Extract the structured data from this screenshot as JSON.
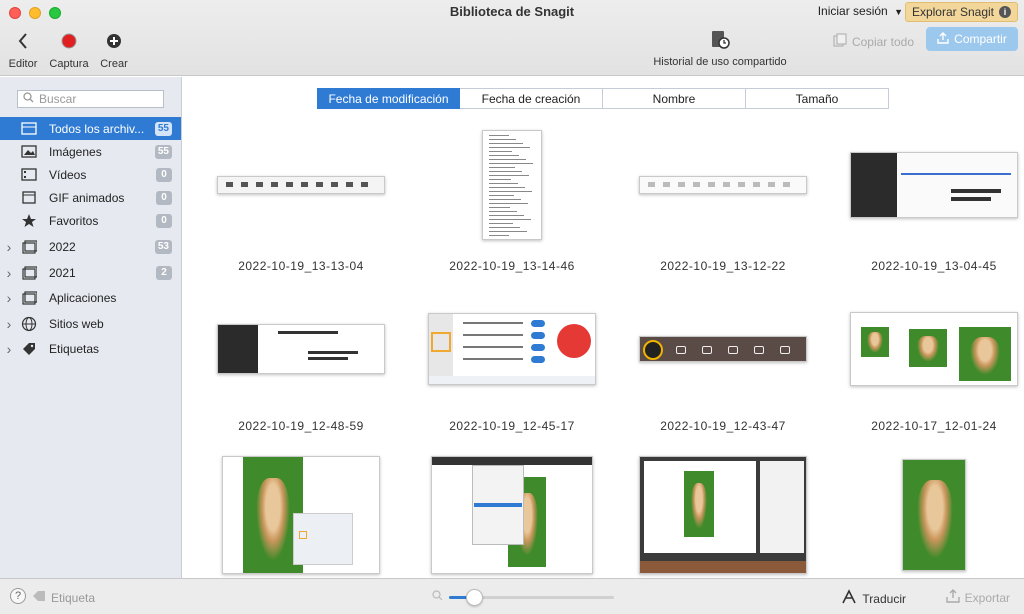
{
  "window": {
    "title": "Biblioteca de Snagit"
  },
  "toolbar": {
    "editor_label": "Editor",
    "capture_label": "Captura",
    "create_label": "Crear",
    "history_label": "Historial de uso compartido",
    "login_label": "Iniciar sesión",
    "explore_label": "Explorar Snagit",
    "copy_all_label": "Copiar todo",
    "share_label": "Compartir"
  },
  "sidebar": {
    "search_placeholder": "Buscar",
    "items": [
      {
        "label": "Todos los archiv...",
        "count": "55",
        "icon": "library-icon",
        "active": true,
        "expandable": false
      },
      {
        "label": "Imágenes",
        "count": "55",
        "icon": "image-icon",
        "expandable": false
      },
      {
        "label": "Vídeos",
        "count": "0",
        "icon": "video-icon",
        "expandable": false
      },
      {
        "label": "GIF animados",
        "count": "0",
        "icon": "gif-icon",
        "expandable": false
      },
      {
        "label": "Favoritos",
        "count": "0",
        "icon": "star-icon",
        "expandable": false
      },
      {
        "label": "2022",
        "count": "53",
        "icon": "calendar-icon",
        "expandable": true
      },
      {
        "label": "2021",
        "count": "2",
        "icon": "calendar-icon",
        "expandable": true
      },
      {
        "label": "Aplicaciones",
        "count": "",
        "icon": "apps-icon",
        "expandable": true
      },
      {
        "label": "Sitios web",
        "count": "",
        "icon": "globe-icon",
        "expandable": true
      },
      {
        "label": "Etiquetas",
        "count": "",
        "icon": "tag-icon",
        "expandable": true
      }
    ]
  },
  "sort": {
    "options": [
      "Fecha de modificación",
      "Fecha de creación",
      "Nombre",
      "Tamaño"
    ],
    "selected": "Fecha de modificación"
  },
  "thumbnails": [
    {
      "name": "2022-10-19_13-13-04",
      "kind": "toolbar"
    },
    {
      "name": "2022-10-19_13-14-46",
      "kind": "menu"
    },
    {
      "name": "2022-10-19_13-12-22",
      "kind": "toolbar-light"
    },
    {
      "name": "2022-10-19_13-04-45",
      "kind": "web-dark"
    },
    {
      "name": "2022-10-19_12-48-59",
      "kind": "web-light"
    },
    {
      "name": "2022-10-19_12-45-17",
      "kind": "capture-panel"
    },
    {
      "name": "2022-10-19_12-43-47",
      "kind": "menubar"
    },
    {
      "name": "2022-10-17_12-01-24",
      "kind": "dog-compare"
    },
    {
      "name": "",
      "kind": "dog-dialog"
    },
    {
      "name": "",
      "kind": "dog-menu"
    },
    {
      "name": "",
      "kind": "dog-desktop"
    },
    {
      "name": "",
      "kind": "dog-photo"
    }
  ],
  "bottombar": {
    "help_label": "?",
    "tag_label": "Etiqueta",
    "zoom_level": 0.15,
    "translate_label": "Traducir",
    "export_label": "Exportar"
  },
  "colors": {
    "accent": "#2f7bd4",
    "explore_bg": "#f3d79a",
    "share_bg": "#9cc8ee"
  }
}
